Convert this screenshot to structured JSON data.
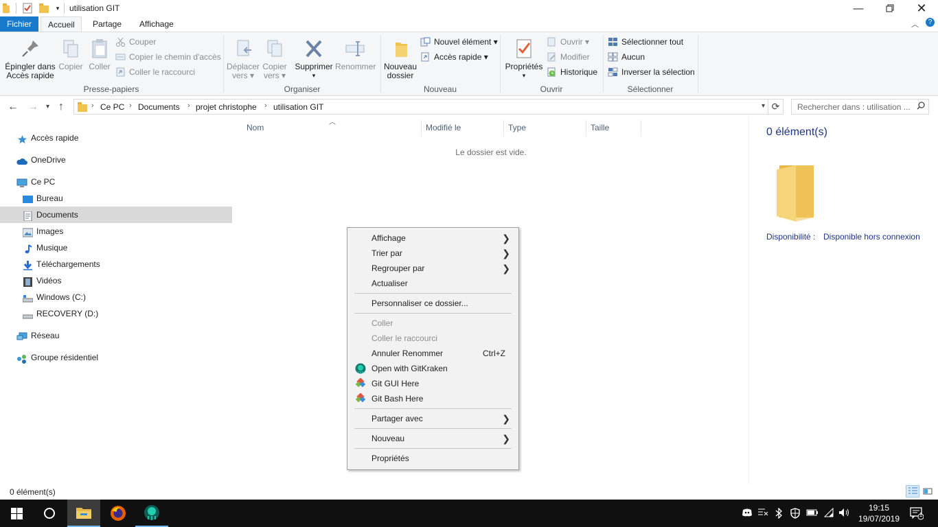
{
  "window": {
    "title": "utilisation GIT"
  },
  "ribbon_tabs": [
    "Fichier",
    "Accueil",
    "Partage",
    "Affichage"
  ],
  "ribbon": {
    "presse_papiers": {
      "label": "Presse-papiers",
      "pin_line1": "Épingler dans",
      "pin_line2": "Accès rapide",
      "copy": "Copier",
      "paste": "Coller",
      "cut": "Couper",
      "copy_path": "Copier le chemin d'accès",
      "paste_shortcut": "Coller le raccourci"
    },
    "organiser": {
      "label": "Organiser",
      "move_line1": "Déplacer",
      "move_line2": "vers",
      "copyto_line1": "Copier",
      "copyto_line2": "vers",
      "delete": "Supprimer",
      "rename": "Renommer"
    },
    "nouveau": {
      "label": "Nouveau",
      "newfolder_line1": "Nouveau",
      "newfolder_line2": "dossier",
      "new_item": "Nouvel élément",
      "quick_access": "Accès rapide"
    },
    "ouvrir": {
      "label": "Ouvrir",
      "properties": "Propriétés",
      "open": "Ouvrir",
      "edit": "Modifier",
      "history": "Historique"
    },
    "selectionner": {
      "label": "Sélectionner",
      "select_all": "Sélectionner tout",
      "select_none": "Aucun",
      "invert": "Inverser la sélection"
    }
  },
  "address": {
    "crumbs": [
      "Ce PC",
      "Documents",
      "projet christophe",
      "utilisation GIT"
    ],
    "search_placeholder": "Rechercher dans : utilisation ..."
  },
  "nav": {
    "items": [
      {
        "label": "Accès rapide"
      },
      {
        "label": "OneDrive"
      },
      {
        "label": "Ce PC"
      },
      {
        "label": "Bureau"
      },
      {
        "label": "Documents"
      },
      {
        "label": "Images"
      },
      {
        "label": "Musique"
      },
      {
        "label": "Téléchargements"
      },
      {
        "label": "Vidéos"
      },
      {
        "label": "Windows (C:)"
      },
      {
        "label": "RECOVERY (D:)"
      },
      {
        "label": "Réseau"
      },
      {
        "label": "Groupe résidentiel"
      }
    ],
    "selected": "Documents"
  },
  "content": {
    "columns": [
      "Nom",
      "Modifié le",
      "Type",
      "Taille"
    ],
    "empty_message": "Le dossier est vide."
  },
  "details": {
    "count": "0 élément(s)",
    "availability_label": "Disponibilité :",
    "availability_value": "Disponible hors connexion"
  },
  "status": {
    "text": "0 élément(s)"
  },
  "context_menu": {
    "items": [
      {
        "label": "Affichage",
        "submenu": true
      },
      {
        "label": "Trier par",
        "submenu": true
      },
      {
        "label": "Regrouper par",
        "submenu": true
      },
      {
        "label": "Actualiser"
      },
      {
        "label": "Personnaliser ce dossier..."
      },
      {
        "label": "Coller",
        "disabled": true
      },
      {
        "label": "Coller le raccourci",
        "disabled": true
      },
      {
        "label": "Annuler Renommer",
        "shortcut": "Ctrl+Z"
      },
      {
        "label": "Open with GitKraken",
        "icon": "gitkraken-icon"
      },
      {
        "label": "Git GUI Here",
        "icon": "git-icon"
      },
      {
        "label": "Git Bash Here",
        "icon": "git-icon"
      },
      {
        "label": "Partager avec",
        "submenu": true
      },
      {
        "label": "Nouveau",
        "submenu": true
      },
      {
        "label": "Propriétés"
      }
    ]
  },
  "taskbar": {
    "time": "19:15",
    "date": "19/07/2019",
    "notification_count": "1"
  },
  "colors": {
    "accent": "#1979ca",
    "folder": "#f0c34e",
    "taskbar": "#101010",
    "details_text": "#1e3287"
  }
}
